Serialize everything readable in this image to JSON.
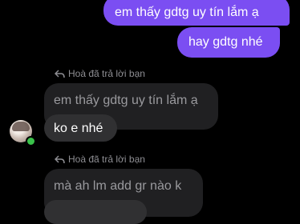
{
  "messages": {
    "out1": "em thấy gdtg uy tín lắm ạ",
    "out2": "hay gdtg nhé",
    "reply1_label": "Hoà đã trả lời bạn",
    "reply1_quote": "em thấy gdtg uy tín lắm ạ",
    "inc1": "ko e nhé",
    "reply2_label": "Hoà đã trả lời bạn",
    "reply2_quote": "mà ah lm add gr nào k"
  },
  "contact": {
    "online": true
  },
  "colors": {
    "outgoing": "#7b4ef2",
    "incoming": "#303032",
    "quoted": "#202022",
    "background": "#000000"
  }
}
